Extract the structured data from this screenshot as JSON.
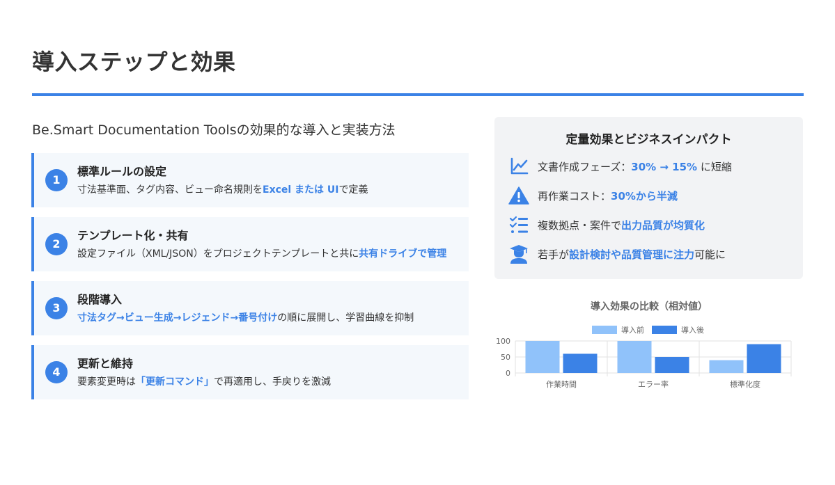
{
  "page": {
    "title": "導入ステップと効果",
    "subtitle": "Be.Smart Documentation Toolsの効果的な導入と実装方法"
  },
  "steps": [
    {
      "number": "1",
      "title": "標準ルールの設定",
      "desc_pre": "寸法基準面、タグ内容、ビュー命名規則を",
      "desc_hl": "Excel または UI",
      "desc_post": "で定義"
    },
    {
      "number": "2",
      "title": "テンプレート化・共有",
      "desc_pre": "設定ファイル（XML/JSON）をプロジェクトテンプレートと共に",
      "desc_hl": "共有ドライブで管理",
      "desc_post": ""
    },
    {
      "number": "3",
      "title": "段階導入",
      "desc_pre": "",
      "desc_hl": "寸法タグ→ビュー生成→レジェンド→番号付け",
      "desc_post": "の順に展開し、学習曲線を抑制"
    },
    {
      "number": "4",
      "title": "更新と維持",
      "desc_pre": "要素変更時は",
      "desc_hl": "「更新コマンド」",
      "desc_post": "で再適用し、手戻りを激減"
    }
  ],
  "impact": {
    "title": "定量効果とビジネスインパクト",
    "items": [
      {
        "icon": "line-chart-icon",
        "pre": "文書作成フェーズ：",
        "hl": "30% → 15%",
        "post": " に短縮"
      },
      {
        "icon": "warning-icon",
        "pre": "再作業コスト：",
        "hl": "30%から半減",
        "post": ""
      },
      {
        "icon": "checklist-icon",
        "pre": "複数拠点・案件で",
        "hl": "出力品質が均質化",
        "post": ""
      },
      {
        "icon": "graduate-icon",
        "pre": "若手が",
        "hl": "設計検討や品質管理に注力",
        "post": "可能に"
      }
    ]
  },
  "chart_data": {
    "type": "bar",
    "title": "導入効果の比較（相対値）",
    "categories": [
      "作業時間",
      "エラー率",
      "標準化度"
    ],
    "series": [
      {
        "name": "導入前",
        "values": [
          100,
          100,
          40
        ],
        "color": "#90c2fa"
      },
      {
        "name": "導入後",
        "values": [
          60,
          50,
          90
        ],
        "color": "#3b82e6"
      }
    ],
    "yticks": [
      0,
      50,
      100
    ],
    "ylim": [
      0,
      100
    ],
    "legend": "top",
    "grid": true
  },
  "colors": {
    "accent": "#3b82e6",
    "light_bar": "#90c2fa"
  }
}
